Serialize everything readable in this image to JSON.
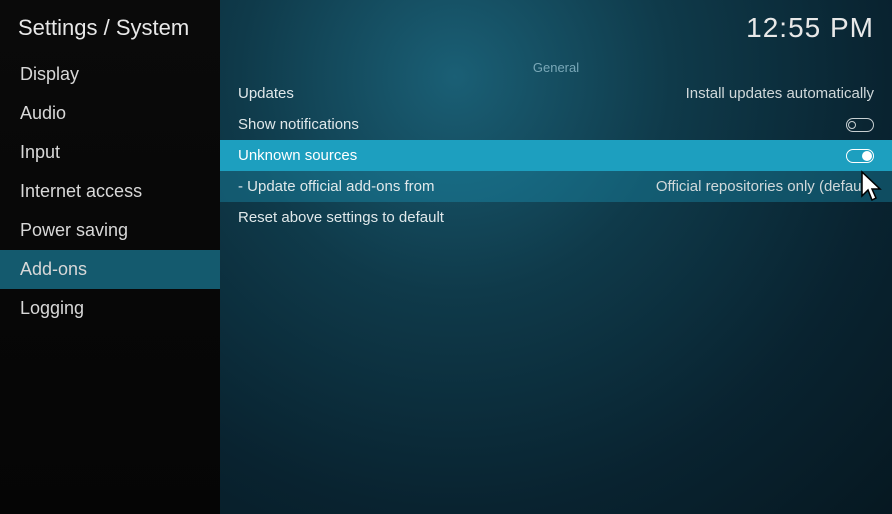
{
  "header": {
    "breadcrumb": "Settings / System",
    "time": "12:55 PM"
  },
  "sidebar": {
    "items": [
      {
        "label": "Display",
        "selected": false
      },
      {
        "label": "Audio",
        "selected": false
      },
      {
        "label": "Input",
        "selected": false
      },
      {
        "label": "Internet access",
        "selected": false
      },
      {
        "label": "Power saving",
        "selected": false
      },
      {
        "label": "Add-ons",
        "selected": true
      },
      {
        "label": "Logging",
        "selected": false
      }
    ]
  },
  "main": {
    "section_label": "General",
    "settings": {
      "updates": {
        "label": "Updates",
        "value": "Install updates automatically"
      },
      "show_notifications": {
        "label": "Show notifications",
        "toggle": "off"
      },
      "unknown_sources": {
        "label": "Unknown sources",
        "toggle": "on"
      },
      "update_official": {
        "label": "- Update official add-ons from",
        "value": "Official repositories only (default)"
      },
      "reset": {
        "label": "Reset above settings to default"
      }
    }
  }
}
